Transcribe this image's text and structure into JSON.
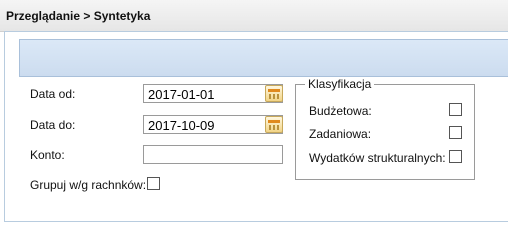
{
  "header": {
    "breadcrumb": "Przeglądanie > Syntetyka"
  },
  "form": {
    "date_from": {
      "label": "Data od:",
      "value": "2017-01-01"
    },
    "date_to": {
      "label": "Data do:",
      "value": "2017-10-09"
    },
    "account": {
      "label": "Konto:",
      "value": ""
    },
    "group_by_accounts": {
      "label": "Grupuj w/g rachnków:",
      "checked": false
    }
  },
  "classification": {
    "legend": "Klasyfikacja",
    "items": [
      {
        "label": "Budżetowa:",
        "checked": false
      },
      {
        "label": "Zadaniowa:",
        "checked": false
      },
      {
        "label": "Wydatków strukturalnych:",
        "checked": false
      }
    ]
  },
  "icons": {
    "calendar": "calendar-icon"
  }
}
